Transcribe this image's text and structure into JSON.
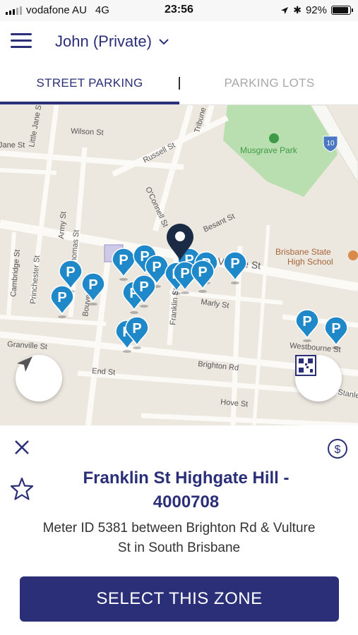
{
  "status_bar": {
    "carrier": "vodafone AU",
    "network": "4G",
    "time": "23:56",
    "battery_percent": "92%",
    "battery_level": 0.92
  },
  "header": {
    "account_label": "John (Private)"
  },
  "tabs": [
    {
      "label": "STREET PARKING",
      "active": true
    },
    {
      "label": "PARKING LOTS",
      "active": false
    }
  ],
  "map": {
    "streets": [
      "Wilson St",
      "Little Jane St",
      "Jane St",
      "Russell St",
      "Musgrave Park",
      "Brisbane State High School",
      "Bouverie St",
      "Besant St",
      "Vulture St",
      "O'Connell St",
      "Marly St",
      "Franklin St",
      "Cambridge St",
      "Princhester St",
      "Army St",
      "Thomas St",
      "Granville St",
      "Brighton Rd",
      "End St",
      "Hove St",
      "Westbourne St",
      "Tribune St",
      "Stanley St"
    ],
    "route_badge": "10",
    "pin_letter": "P",
    "pin_color": "#1e88c8",
    "selected_pin_color": "#1b2b45"
  },
  "sheet": {
    "title": "Franklin St Highgate Hill - 4000708",
    "description": "Meter ID 5381 between Brighton Rd & Vulture St in South Brisbane",
    "select_button": "SELECT THIS ZONE"
  },
  "colors": {
    "brand": "#2b2f78",
    "map_bg": "#ece7df",
    "park_green": "#b9dfb0"
  }
}
